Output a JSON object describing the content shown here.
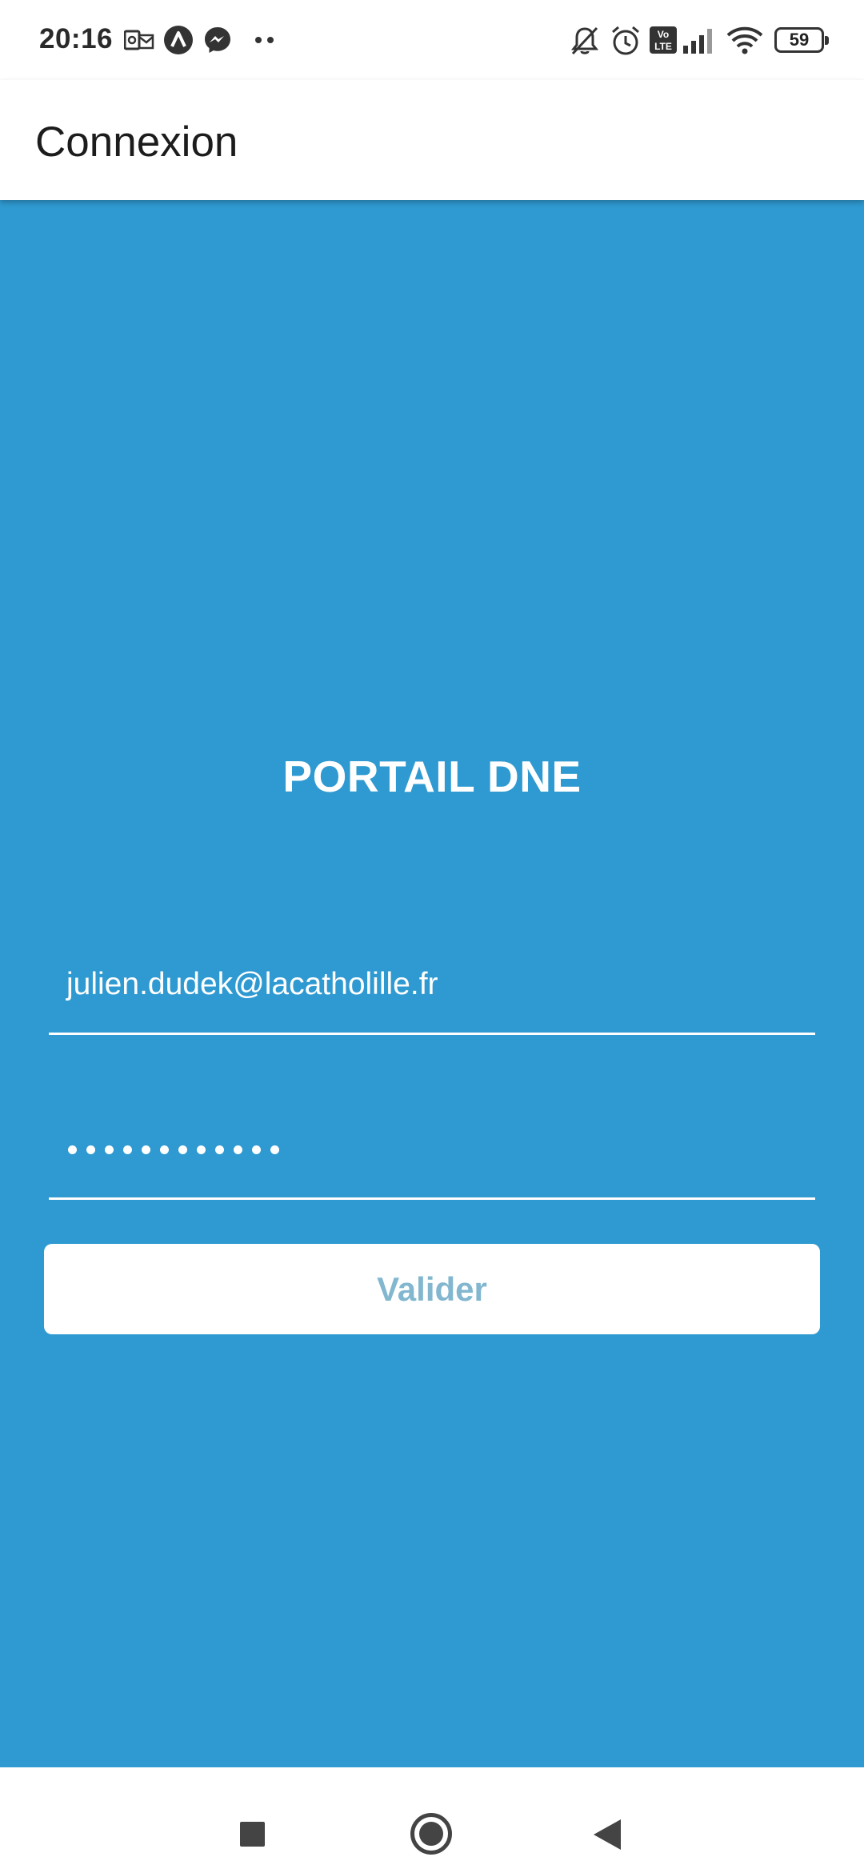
{
  "status_bar": {
    "time": "20:16",
    "battery": "59",
    "left_icons": [
      "outlook-icon",
      "avast-icon",
      "messenger-icon",
      "more-dots-icon"
    ],
    "right_icons": [
      "bell-off-icon",
      "alarm-icon",
      "volte-icon",
      "signal-icon",
      "wifi-icon",
      "battery-icon"
    ]
  },
  "app_bar": {
    "title": "Connexion"
  },
  "login": {
    "title": "PORTAIL DNE",
    "email_value": "julien.dudek@lacatholille.fr",
    "password_mask": "••••••••••••",
    "password_length": 12,
    "submit_label": "Valider"
  },
  "colors": {
    "background": "#2f9ad1",
    "submit_text": "#82b7cf"
  },
  "nav_bar": {
    "buttons": [
      "recent-apps",
      "home",
      "back"
    ]
  }
}
